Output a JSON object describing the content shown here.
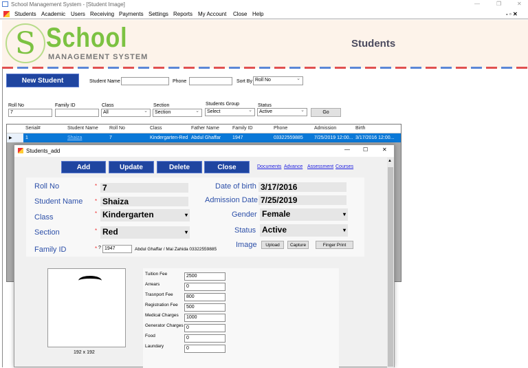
{
  "window": {
    "title": "School Management System - [Student Image]"
  },
  "menu": [
    "Students",
    "Academic",
    "Users",
    "Receiving",
    "Payments",
    "Settings",
    "Reports",
    "My Account",
    "Close",
    "Help"
  ],
  "logo": {
    "big": "School",
    "small": "MANAGEMENT SYSTEM",
    "letter": "S"
  },
  "page_title": "Students",
  "search": {
    "new_student": "New Student",
    "student_name_label": "Student Name",
    "student_name_value": "",
    "phone_label": "Phone",
    "phone_value": "",
    "sort_by_label": "Sort By",
    "sort_by_value": "Roll No"
  },
  "filters": {
    "roll_no_label": "Roll No",
    "roll_no_value": "7",
    "family_id_label": "Family ID",
    "family_id_value": "",
    "class_label": "Class",
    "class_value": "All",
    "section_label": "Section",
    "section_value": "Section",
    "group_label": "Students Group",
    "group_value": "Select",
    "status_label": "Status",
    "status_value": "Active",
    "go": "Go"
  },
  "grid": {
    "columns": [
      "Serial#",
      "Student Name",
      "Roll No",
      "Class",
      "Father Name",
      "Family ID",
      "Phone",
      "Admission",
      "Birth"
    ],
    "rows": [
      [
        "1",
        "Shaiza",
        "7",
        "Kindergarten-Red",
        "Abdul Ghaffar",
        "1947",
        "03322559885",
        "7/25/2019 12:00...",
        "3/17/2016 12:00..."
      ]
    ]
  },
  "dialog": {
    "title": "Students_add",
    "buttons": [
      "Add",
      "Update",
      "Delete",
      "Close"
    ],
    "links": [
      "Documents",
      "Advance",
      "Assessment",
      "Courses"
    ],
    "fields": {
      "roll_no_label": "Roll No",
      "roll_no": "7",
      "student_name_label": "Student Name",
      "student_name": "Shaiza",
      "class_label": "Class",
      "class": "Kindergarten",
      "section_label": "Section",
      "section": "Red",
      "family_id_label": "Family ID",
      "family_id": "1947",
      "family_help": "?",
      "family_info": "Abdul Ghaffar / Mai Zahida 03322559885",
      "dob_label": "Date of birth",
      "dob": "3/17/2016",
      "admission_label": "Admission Date",
      "admission": "7/25/2019",
      "gender_label": "Gender",
      "gender": "Female",
      "status_label": "Status",
      "status": "Active",
      "image_label": "Image",
      "required_mark": "*"
    },
    "image_buttons": [
      "Upload",
      "Capture",
      "Finger Print"
    ],
    "image_size": "192 x 192",
    "fees": [
      {
        "label": "Tuition Fee",
        "value": "2500"
      },
      {
        "label": "Arrears",
        "value": "0"
      },
      {
        "label": "Trasnport Fee",
        "value": "800"
      },
      {
        "label": "Registration Fee",
        "value": "500"
      },
      {
        "label": "Medical Charges",
        "value": "1000"
      },
      {
        "label": "Generator Charges",
        "value": "0"
      },
      {
        "label": "Food",
        "value": "0"
      },
      {
        "label": "Laundary",
        "value": "0"
      }
    ]
  }
}
